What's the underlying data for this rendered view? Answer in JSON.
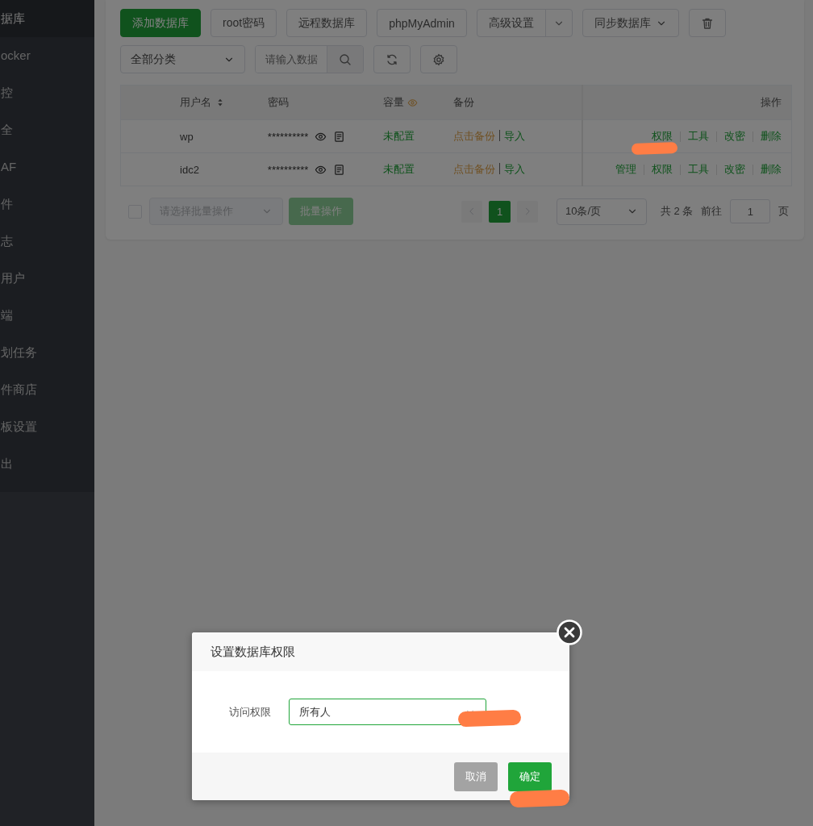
{
  "sidebar": {
    "items": [
      {
        "label": "据库",
        "selected": true
      },
      {
        "label": "ocker",
        "selected": false
      },
      {
        "label": "控",
        "selected": false
      },
      {
        "label": "全",
        "selected": false
      },
      {
        "label": "AF",
        "selected": false
      },
      {
        "label": "件",
        "selected": false
      },
      {
        "label": "志",
        "selected": false
      },
      {
        "label": "用户",
        "selected": false
      },
      {
        "label": "端",
        "selected": false
      },
      {
        "label": "划任务",
        "selected": false
      },
      {
        "label": "件商店",
        "selected": false
      },
      {
        "label": "板设置",
        "selected": false
      },
      {
        "label": "出",
        "selected": false
      }
    ]
  },
  "toolbar": {
    "buttons": [
      {
        "label": "添加数据库",
        "kind": "primary"
      },
      {
        "label": "root密码",
        "kind": "plain"
      },
      {
        "label": "远程数据库",
        "kind": "plain"
      },
      {
        "label": "phpMyAdmin",
        "kind": "plain"
      },
      {
        "label": "高级设置",
        "kind": "split"
      },
      {
        "label": "同步数据库",
        "kind": "dropdown"
      },
      {
        "kind": "trash"
      }
    ]
  },
  "filter": {
    "category": "全部分类",
    "search_placeholder": "请输入数据"
  },
  "table": {
    "columns": [
      {
        "label": "用户名",
        "kind": "sortable"
      },
      {
        "label": "密码",
        "kind": "plain"
      },
      {
        "label": "容量",
        "kind": "hint"
      },
      {
        "label": "备份",
        "kind": "plain"
      },
      {
        "label": "操作",
        "kind": "plain"
      }
    ],
    "rows": [
      {
        "username": "wp",
        "password": "**********",
        "capacity": "未配置",
        "backup": "点击备份",
        "import": "导入",
        "actions": [
          "权限",
          "工具",
          "改密",
          "删除"
        ]
      },
      {
        "username": "idc2",
        "password": "**********",
        "capacity": "未配置",
        "backup": "点击备份",
        "import": "导入",
        "actions": [
          "管理",
          "权限",
          "工具",
          "改密",
          "删除"
        ]
      }
    ]
  },
  "footer": {
    "select_all_checked": false,
    "batch_placeholder": "请选择批量操作",
    "batch_button": "批量操作",
    "pages": [
      {
        "label": "1",
        "selected": true
      }
    ],
    "page_size": "10条/页",
    "total": "共 2 条",
    "goto": "前往",
    "goto_value": "1",
    "page_unit": "页"
  },
  "dialog": {
    "title": "设置数据库权限",
    "field_label": "访问权限",
    "field_value": "所有人",
    "buttons": [
      {
        "label": "取消",
        "kind": "cancel"
      },
      {
        "label": "确定",
        "kind": "confirm"
      }
    ]
  },
  "highlight_strokes": [
    {
      "kind": "under-link"
    },
    {
      "kind": "under-select"
    },
    {
      "kind": "under-confirm"
    }
  ]
}
